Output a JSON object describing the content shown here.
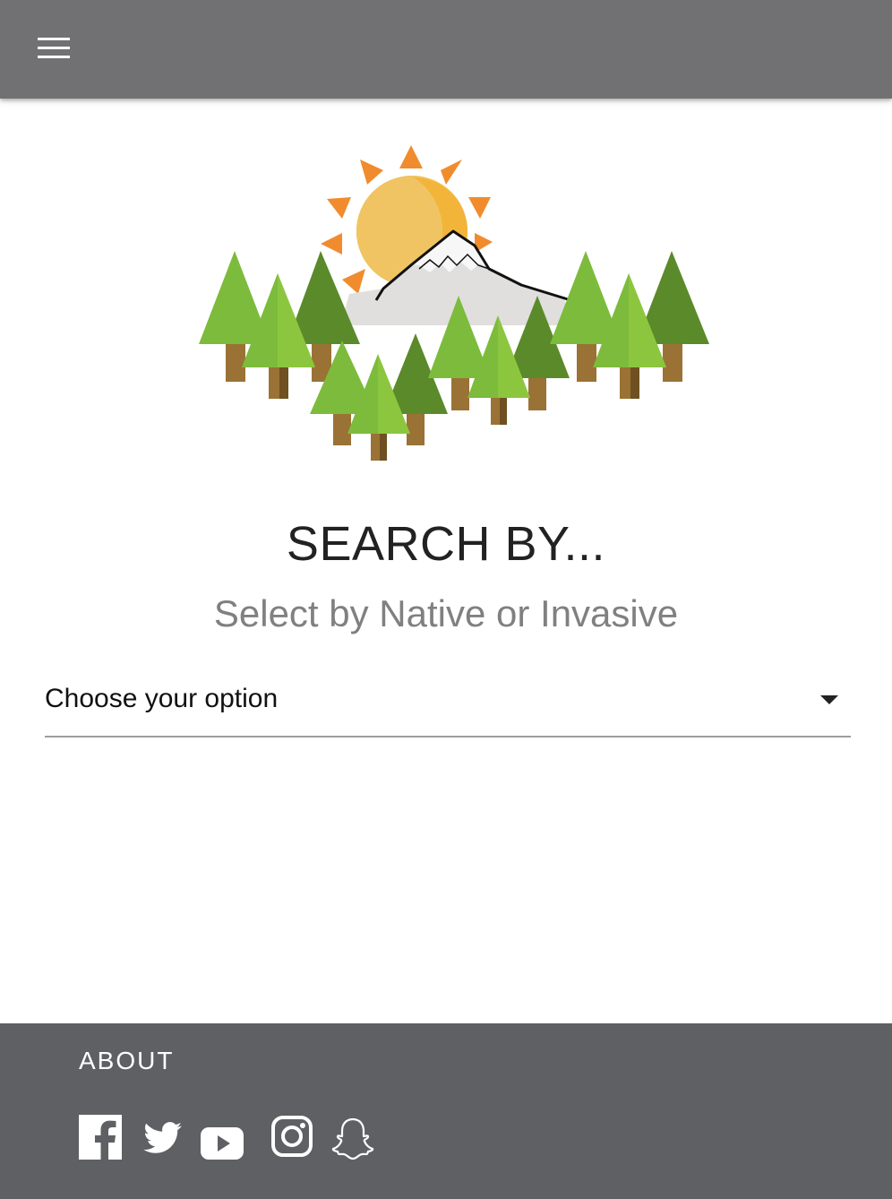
{
  "header": {
    "menu_icon": "hamburger-menu-icon"
  },
  "hero": {
    "logo": "sun-mountain-forest-logo",
    "colors": {
      "sun": "#F0C462",
      "sun_shade": "#F2B53A",
      "rays": "#F08C2E",
      "mountain": "#E1DEDE",
      "snow": "#F7F7F7",
      "tree_light": "#7DBB3C",
      "tree_bright": "#8CC63F",
      "tree_dark": "#5B8A2A",
      "trunk": "#9A7235",
      "trunk_shade": "#6F5021"
    }
  },
  "main": {
    "title": "SEARCH BY...",
    "subtitle": "Select by Native or Invasive",
    "select": {
      "selected": "Choose your option",
      "icon": "caret-down-icon"
    }
  },
  "footer": {
    "about_label": "ABOUT",
    "social_icons": [
      "facebook-icon",
      "twitter-icon",
      "youtube-icon",
      "instagram-icon",
      "snapchat-icon"
    ],
    "colors": {
      "background": "#5F6063",
      "icons": "#FFFFFF"
    }
  },
  "colors": {
    "topbar": "#717173",
    "title_text": "#222222",
    "subtitle_text": "#808080"
  }
}
